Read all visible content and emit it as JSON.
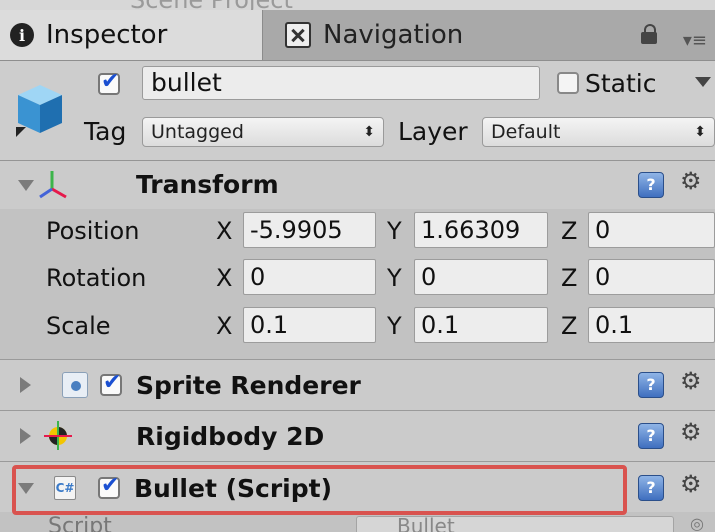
{
  "top_strip": {
    "ghost_text": "Scene  Project"
  },
  "tabs": [
    {
      "label": "Inspector",
      "icon": "info-icon",
      "active": true
    },
    {
      "label": "Navigation",
      "icon": "navigation-icon",
      "active": false
    }
  ],
  "object": {
    "name": "bullet",
    "active": true,
    "static_label": "Static",
    "tag_label": "Tag",
    "tag_value": "Untagged",
    "layer_label": "Layer",
    "layer_value": "Default"
  },
  "transform": {
    "title": "Transform",
    "rows": [
      {
        "label": "Position",
        "x": "-5.9905",
        "y": "1.66309",
        "z": "0"
      },
      {
        "label": "Rotation",
        "x": "0",
        "y": "0",
        "z": "0"
      },
      {
        "label": "Scale",
        "x": "0.1",
        "y": "0.1",
        "z": "0.1"
      }
    ],
    "axis_x": "X",
    "axis_y": "Y",
    "axis_z": "Z"
  },
  "components": [
    {
      "title": "Sprite Renderer",
      "enabled": true
    },
    {
      "title": "Rigidbody 2D",
      "enabled": null
    },
    {
      "title": "Bullet (Script)",
      "enabled": true
    }
  ],
  "script_row": {
    "label": "Script",
    "value": "Bullet"
  },
  "colors": {
    "highlight": "#d9534f",
    "checkmark": "#1a4fd1"
  }
}
